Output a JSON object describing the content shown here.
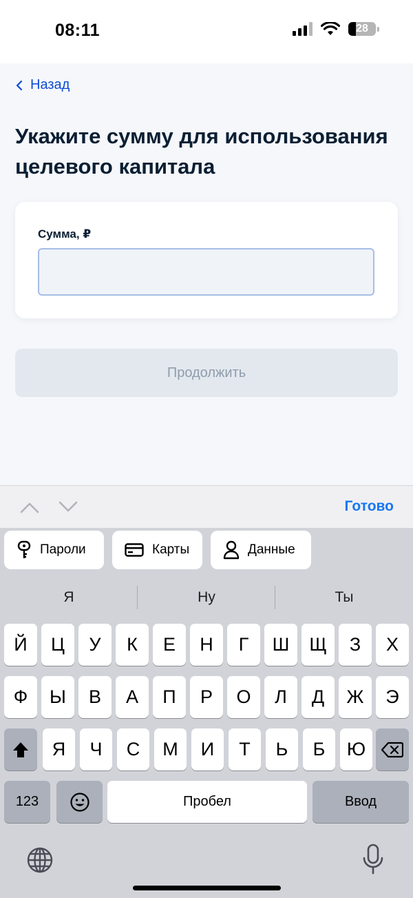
{
  "status": {
    "time": "08:11",
    "battery": "28",
    "battery_level": 0.28
  },
  "nav": {
    "back_label": "Назад"
  },
  "page": {
    "title": "Укажите сумму для использования целевого капитала"
  },
  "form": {
    "amount_label": "Сумма, ₽",
    "amount_value": "",
    "amount_placeholder": ""
  },
  "actions": {
    "continue_label": "Продолжить"
  },
  "keyboard_toolbar": {
    "done_label": "Готово"
  },
  "autofill": {
    "passwords": "Пароли",
    "cards": "Карты",
    "contacts": "Данные"
  },
  "suggestions": [
    "Я",
    "Ну",
    "Ты"
  ],
  "keys": {
    "row1": [
      "Й",
      "Ц",
      "У",
      "К",
      "Е",
      "Н",
      "Г",
      "Ш",
      "Щ",
      "З",
      "Х"
    ],
    "row2": [
      "Ф",
      "Ы",
      "В",
      "А",
      "П",
      "Р",
      "О",
      "Л",
      "Д",
      "Ж",
      "Э"
    ],
    "row3": [
      "Я",
      "Ч",
      "С",
      "М",
      "И",
      "Т",
      "Ь",
      "Б",
      "Ю"
    ],
    "numbers": "123",
    "space": "Пробел",
    "enter": "Ввод"
  }
}
